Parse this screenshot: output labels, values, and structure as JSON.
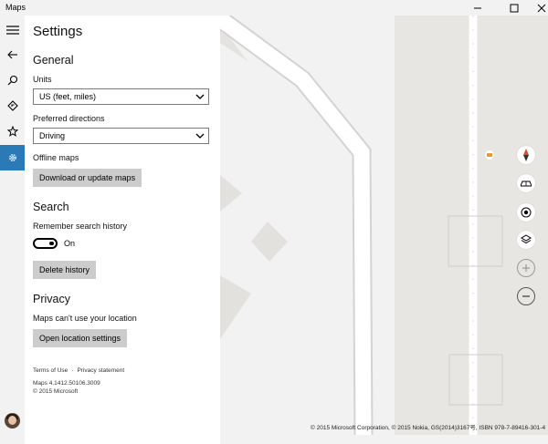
{
  "app": {
    "title": "Maps"
  },
  "rail": {
    "items": [
      {
        "icon": "hamburger-icon"
      },
      {
        "icon": "back-arrow-icon"
      },
      {
        "icon": "search-icon"
      },
      {
        "icon": "directions-icon"
      },
      {
        "icon": "star-icon"
      },
      {
        "icon": "gear-icon"
      }
    ],
    "active_color": "#2b7ab8"
  },
  "settings": {
    "title": "Settings",
    "general": {
      "heading": "General",
      "units_label": "Units",
      "units_value": "US (feet, miles)",
      "directions_label": "Preferred directions",
      "directions_value": "Driving",
      "offline_label": "Offline maps",
      "download_button": "Download or update maps"
    },
    "search": {
      "heading": "Search",
      "history_label": "Remember search history",
      "toggle_state": "On",
      "delete_button": "Delete history"
    },
    "privacy": {
      "heading": "Privacy",
      "location_text": "Maps can't use your location",
      "location_button": "Open location settings"
    },
    "footer": {
      "terms": "Terms of Use",
      "separator": "·",
      "privacy": "Privacy statement",
      "version": "Maps 4.1412.50106.3009",
      "copyright": "© 2015 Microsoft"
    }
  },
  "map": {
    "copyright": "© 2015 Microsoft Corporation, © 2015 Nokia, GS(2014)3167号, ISBN 978-7-89416-301-4",
    "controls": [
      "compass-icon",
      "3d-view-icon",
      "my-location-icon",
      "layers-icon",
      "zoom-in-icon",
      "zoom-out-icon"
    ],
    "poi_color": "#f0962c"
  }
}
